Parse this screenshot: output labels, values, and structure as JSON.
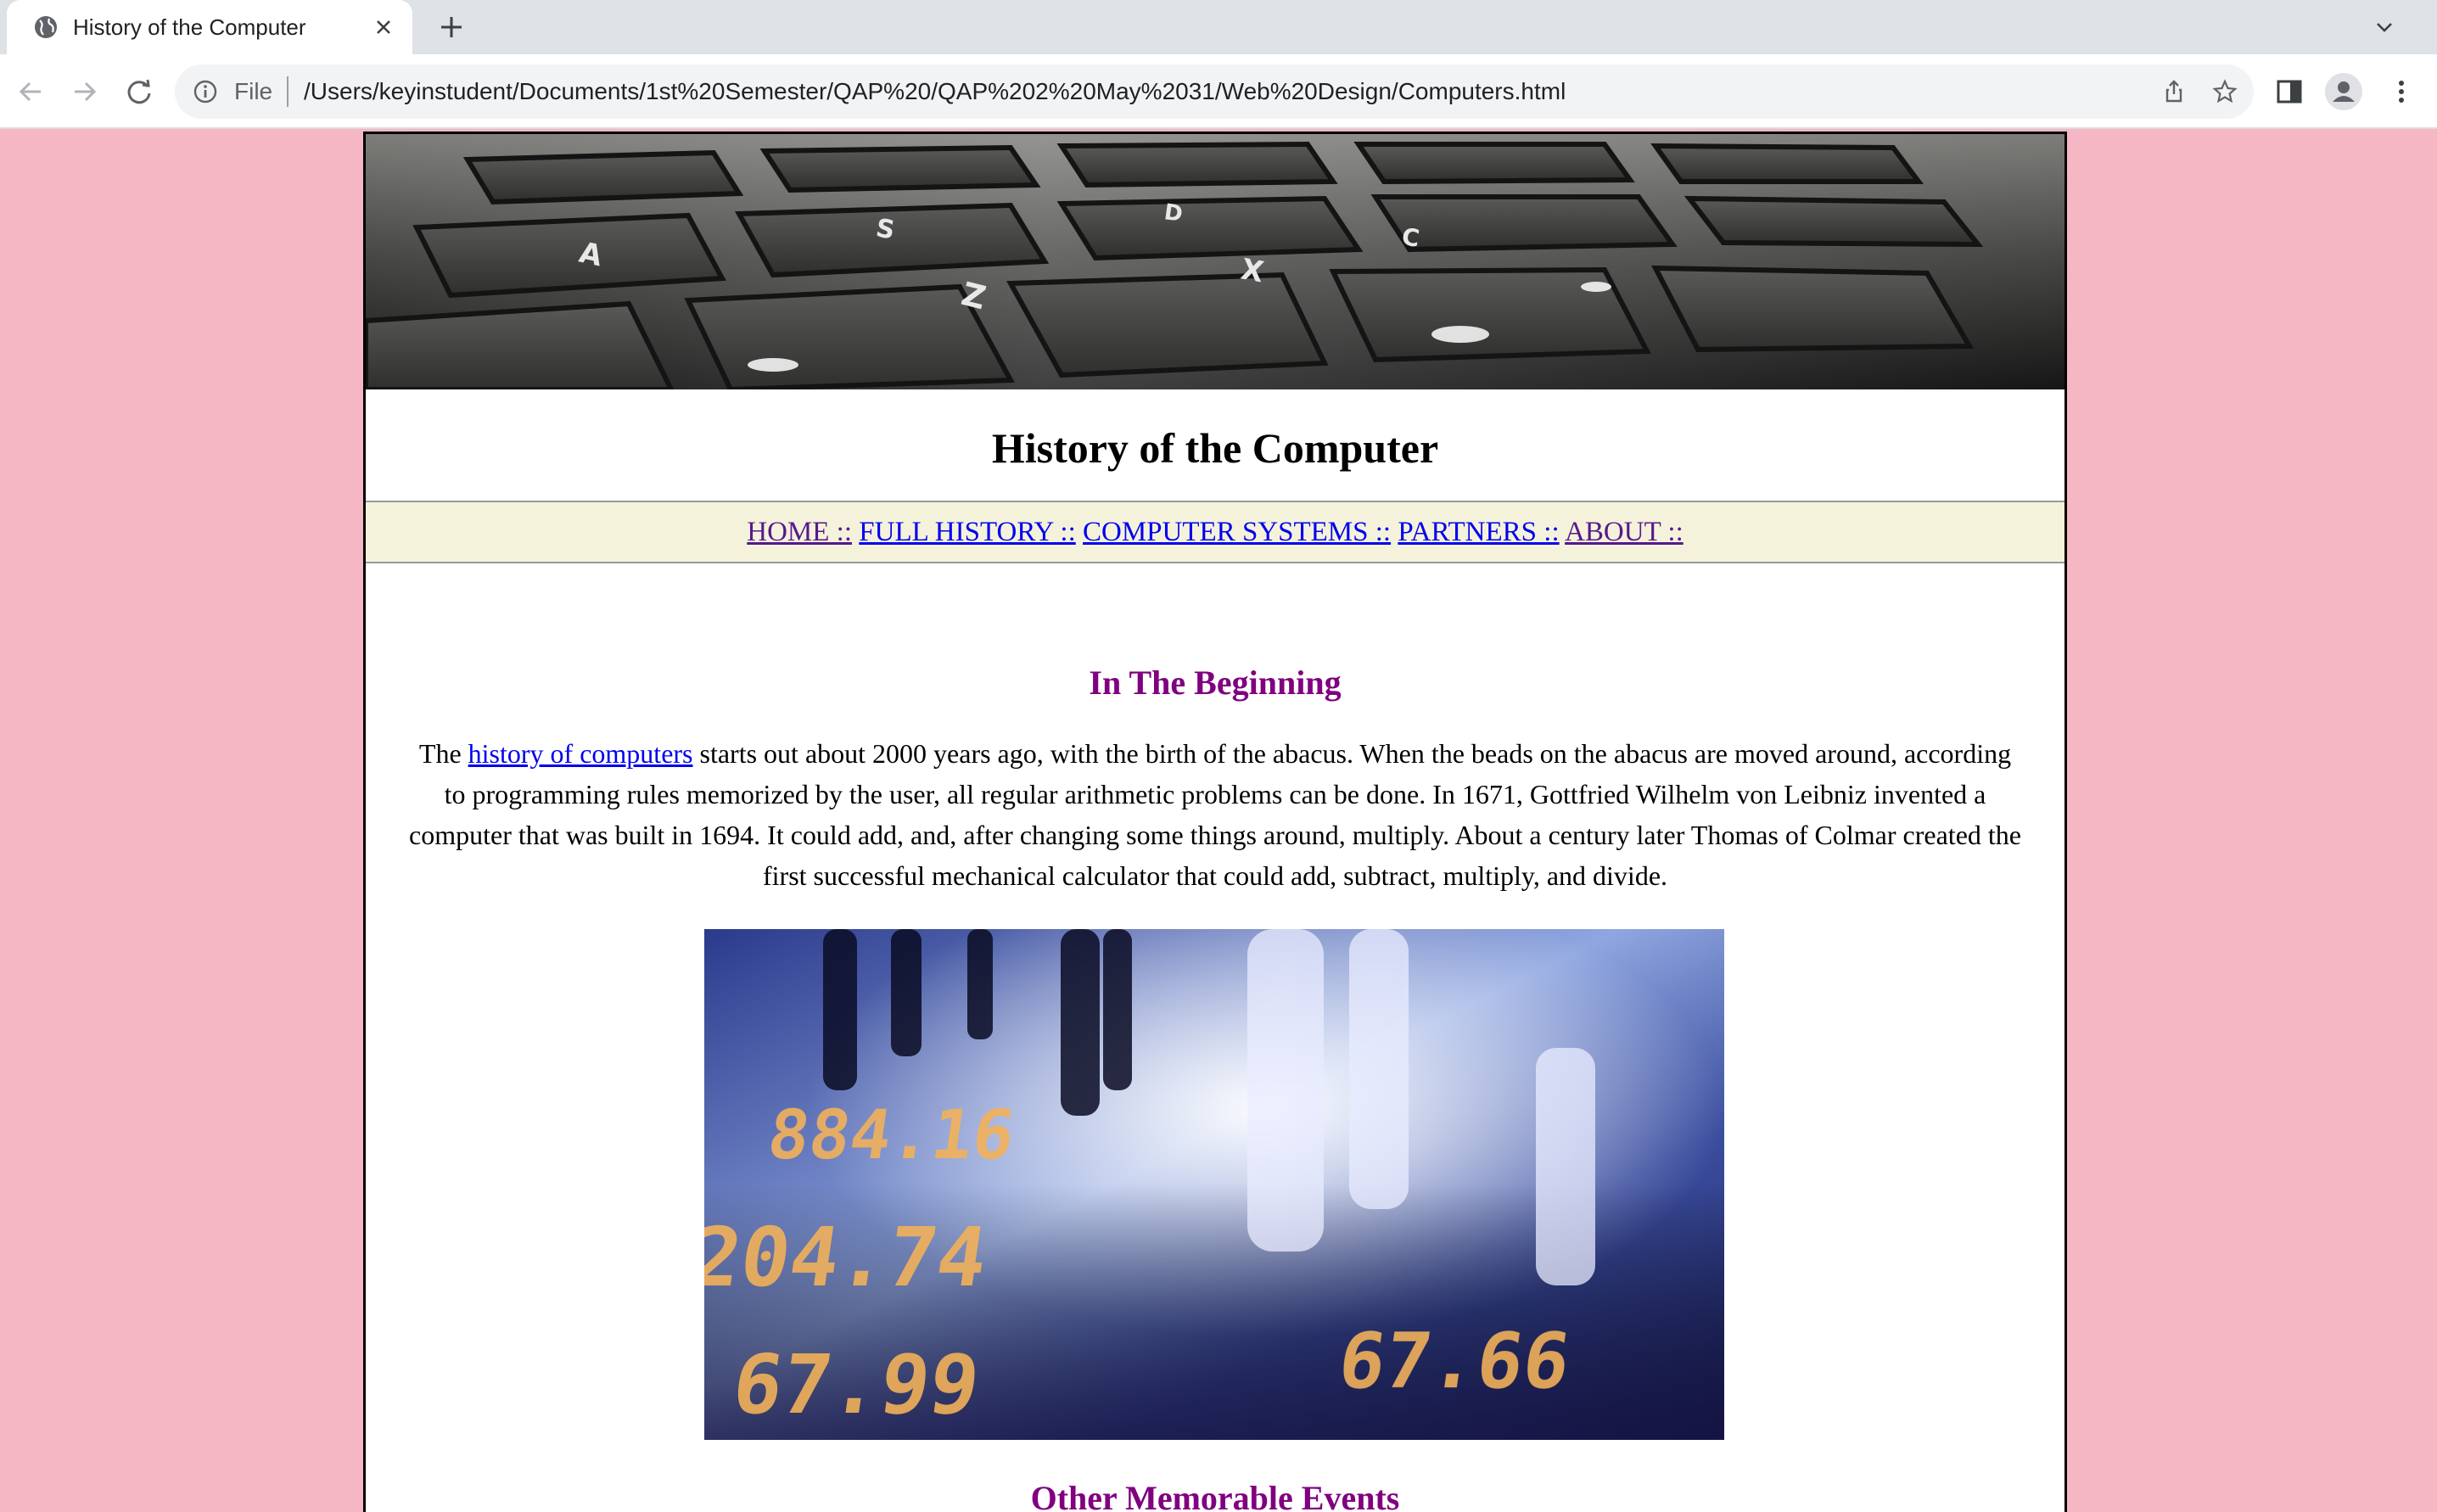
{
  "browser": {
    "tab_title": "History of the Computer",
    "url_scheme": "File",
    "url": "/Users/keyinstudent/Documents/1st%20Semester/QAP%20/QAP%202%20May%2031/Web%20Design/Computers.html"
  },
  "page": {
    "title": "History of the Computer",
    "nav": {
      "home": "HOME ::",
      "full_history": "FULL HISTORY ::",
      "computer_systems": "COMPUTER SYSTEMS ::",
      "partners": "PARTNERS ::",
      "about": "ABOUT ::"
    },
    "section1_heading": "In The Beginning",
    "para_before_link": "The ",
    "para_link": "history of computers",
    "para_after_link": " starts out about 2000 years ago, with the birth of the abacus. When the beads on the abacus are moved around, according to programming rules memorized by the user, all regular arithmetic problems can be done. In 1671, Gottfried Wilhelm von Leibniz invented a computer that was built in 1694. It could add, and, after changing some things around, multiply. About a century later Thomas of Colmar created the first successful mechanical calculator that could add, subtract, multiply, and divide.",
    "photo_digits": [
      "884.16",
      "204.74",
      "67.99",
      "67.66"
    ],
    "section2_heading": "Other Memorable Events"
  },
  "colors": {
    "page_background": "#f4b7c3",
    "heading_purple": "#800080",
    "link_blue": "#0000ee",
    "link_visited": "#551a8b",
    "navbar_background": "#f5f2dc"
  }
}
